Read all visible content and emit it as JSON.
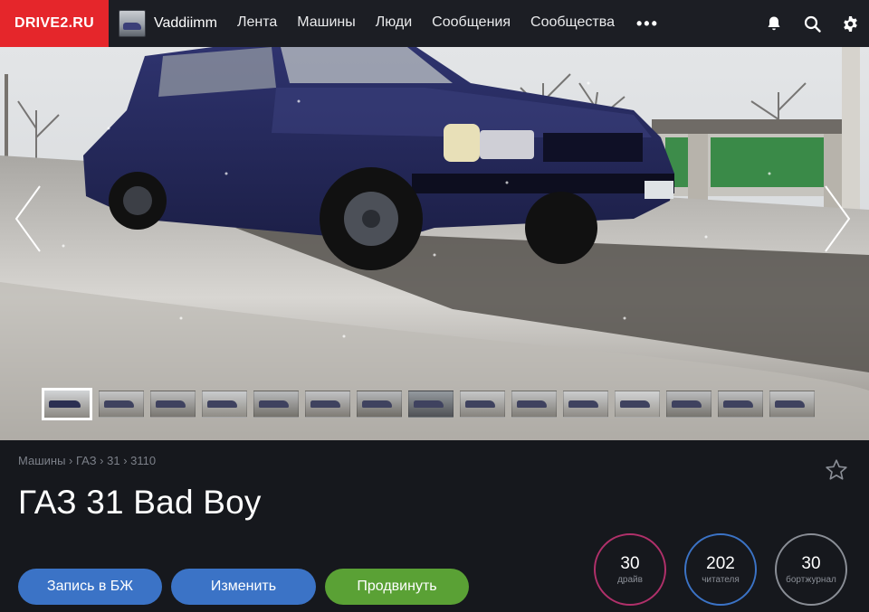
{
  "header": {
    "logo": "DRIVE2.RU",
    "username": "Vaddiimm",
    "nav": [
      "Лента",
      "Машины",
      "Люди",
      "Сообщения",
      "Сообщества"
    ],
    "more": "•••",
    "icons": [
      "bell-icon",
      "search-icon",
      "gear-icon"
    ]
  },
  "gallery": {
    "thumbnail_count": 15,
    "active_index": 0
  },
  "car": {
    "breadcrumb": [
      "Машины",
      "ГАЗ",
      "31",
      "3110"
    ],
    "title": "ГАЗ 31 Bad Boy"
  },
  "actions": {
    "journal_label": "Запись в БЖ",
    "edit_label": "Изменить",
    "promote_label": "Продвинуть"
  },
  "stats": [
    {
      "value": "30",
      "label": "драйв",
      "color": "#b0306a"
    },
    {
      "value": "202",
      "label": "читателя",
      "color": "#3b73c6"
    },
    {
      "value": "30",
      "label": "бортжурнал",
      "color": "#8a8e96"
    }
  ],
  "colors": {
    "brand": "#e5262b",
    "primary_button": "#3b73c6",
    "promote_button": "#5aa135"
  }
}
